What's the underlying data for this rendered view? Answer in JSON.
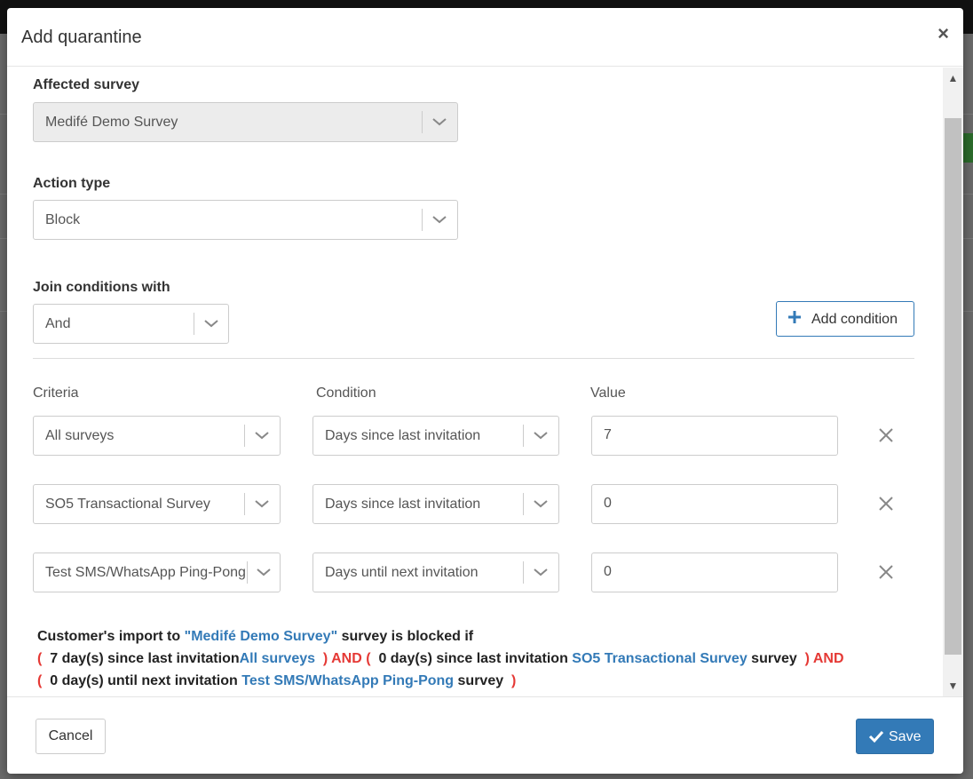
{
  "dialog": {
    "title": "Add quarantine",
    "close_label": "×"
  },
  "form": {
    "affected_survey": {
      "label": "Affected survey",
      "value": "Medifé Demo Survey"
    },
    "action_type": {
      "label": "Action type",
      "value": "Block"
    },
    "join_conditions": {
      "label": "Join conditions with",
      "value": "And"
    },
    "add_condition_label": "Add condition"
  },
  "conditions": {
    "headers": {
      "criteria": "Criteria",
      "condition": "Condition",
      "value": "Value"
    },
    "rows": [
      {
        "criteria": "All surveys",
        "condition": "Days since last invitation",
        "value": "7"
      },
      {
        "criteria": "SO5 Transactional Survey",
        "condition": "Days since last invitation",
        "value": "0"
      },
      {
        "criteria": "Test SMS/WhatsApp Ping-Pong",
        "condition": "Days until next invitation",
        "value": "0"
      }
    ]
  },
  "summary": {
    "prefix": "Customer's import to",
    "survey": "\"Medifé Demo Survey\"",
    "suffix": "survey is blocked if",
    "open_paren": "(",
    "close_paren": ")",
    "and": "AND",
    "survey_word": "survey",
    "clauses": [
      {
        "text": "7 day(s) since last invitation",
        "target": "All surveys"
      },
      {
        "text": "0 day(s) since last invitation",
        "target": "SO5 Transactional Survey"
      },
      {
        "text": "0 day(s) until next invitation",
        "target": "Test SMS/WhatsApp Ping-Pong"
      }
    ]
  },
  "footer": {
    "cancel_label": "Cancel",
    "save_label": "Save"
  },
  "colors": {
    "primary": "#337ab7",
    "danger": "#e53935"
  }
}
